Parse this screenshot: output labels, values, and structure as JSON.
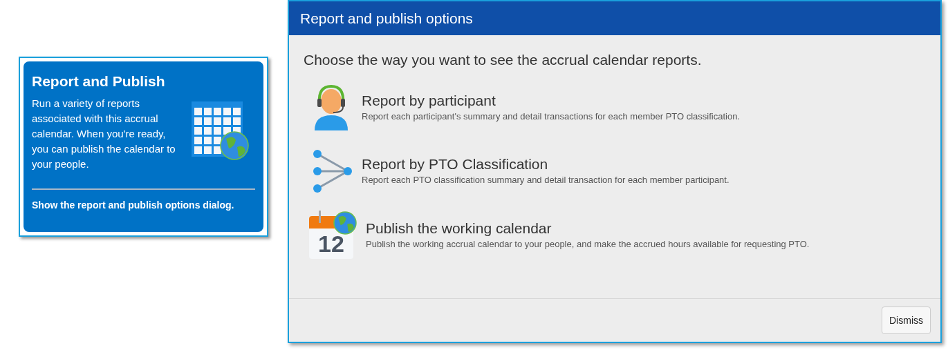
{
  "tile": {
    "title": "Report and Publish",
    "description": "Run a variety of reports associated with this accrual calendar. When you're ready, you can publish the calendar to your people.",
    "action": "Show the report and publish options dialog."
  },
  "dialog": {
    "title": "Report and publish options",
    "prompt": "Choose the way you want to see the accrual calendar reports.",
    "options": [
      {
        "kind": "participant",
        "title": "Report by participant",
        "description": "Report each participant's summary and detail transactions for each member PTO classification."
      },
      {
        "kind": "classification",
        "title": "Report by PTO Classification",
        "description": "Report each PTO classification summary and detail transaction for each member participant."
      },
      {
        "kind": "calendar",
        "icon_text": "12",
        "title": "Publish the working calendar",
        "description": "Publish the working accrual calendar to your people, and make the accrued hours available for requesting PTO."
      }
    ],
    "buttons": [
      "Dismiss"
    ]
  }
}
